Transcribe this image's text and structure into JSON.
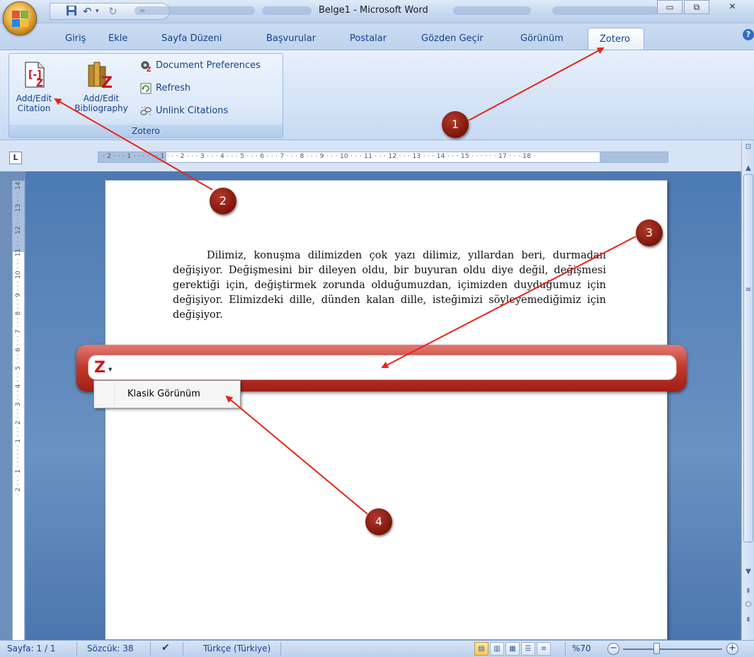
{
  "window": {
    "title": "Belge1 - Microsoft Word",
    "controls": [
      "▭",
      "⧉",
      "✕"
    ]
  },
  "qat": {
    "save_icon": "floppy-icon",
    "undo_icon": "undo-icon",
    "redo_icon": "redo-icon"
  },
  "tabs": [
    "Giriş",
    "Ekle",
    "Sayfa Düzeni",
    "Başvurular",
    "Postalar",
    "Gözden Geçir",
    "Görünüm",
    "Zotero"
  ],
  "active_tab": "Zotero",
  "ribbon": {
    "group_label": "Zotero",
    "add_citation_label_1": "Add/Edit",
    "add_citation_label_2": "Citation",
    "add_bibliography_label_1": "Add/Edit",
    "add_bibliography_label_2": "Bibliography",
    "document_preferences": "Document Preferences",
    "refresh": "Refresh",
    "unlink_citations": "Unlink Citations"
  },
  "ruler": {
    "horizontal": "· 2 · · · 1 · · ·   · · · 1 · · · 2 · · · 3 · · · 4 · · · 5 · · · 6 · · · 7 · · · 8 · · · 9 · · · 10 · · · 11 · · · 12 · · · 13 · · · 14 · · · 15 · · ·   · · · 17 · · · 18 ·",
    "vertical": "· 2 · · · 1 · · ·   · · · 1 · · · 2 · · · 3 · · · 4 · · · 5 · · · 6 · · · 7 · · · 8 · · · 9 · · · 10 · · · 11 · · · 12 · · · 13 · · · 14"
  },
  "document": {
    "paragraph": "Dilimiz, konuşma dilimizden çok yazı dilimiz, yıllardan beri, durmadan değişiyor. Değişmesini bir dileyen oldu, bir buyuran oldu diye değil, değişmesi gerektiği için, değiştirmek zorunda olduğumuzdan, içimizden duyduğumuz için değişiyor. Elimizdeki dille, dünden kalan dille, isteğimizi söyleyemediğimiz için değişiyor."
  },
  "zotero_bar": {
    "logo": "Z",
    "dropdown_item": "Klasik Görünüm"
  },
  "statusbar": {
    "page": "Sayfa: 1 / 1",
    "words": "Sözcük: 38",
    "language": "Türkçe (Türkiye)",
    "zoom": "%70"
  },
  "annotations": {
    "badges": [
      "1",
      "2",
      "3",
      "4"
    ],
    "color": "#e8241a"
  }
}
